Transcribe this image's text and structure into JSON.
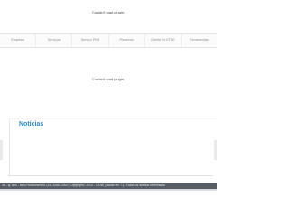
{
  "plugin_message_top": "Couldn't load plugin.",
  "plugin_message_middle": "Couldn't load plugin.",
  "nav": {
    "items": [
      {
        "label": "Empresa"
      },
      {
        "label": "Serviços"
      },
      {
        "label": "Serviço PNB"
      },
      {
        "label": "Parceiros"
      },
      {
        "label": "Cliente IN OTNE"
      },
      {
        "label": "Ferramentas"
      }
    ]
  },
  "news": {
    "title": "Notícias"
  },
  "footer": {
    "text": "45 - sj. 605 - Belo Horizonte/MG (31) 3286-1459 | Copyright© 2014 - OTNE (saúde em T.) - Todos os direitos reservados"
  },
  "colors": {
    "accent": "#2f86c4",
    "footer_bg": "#555c63"
  }
}
